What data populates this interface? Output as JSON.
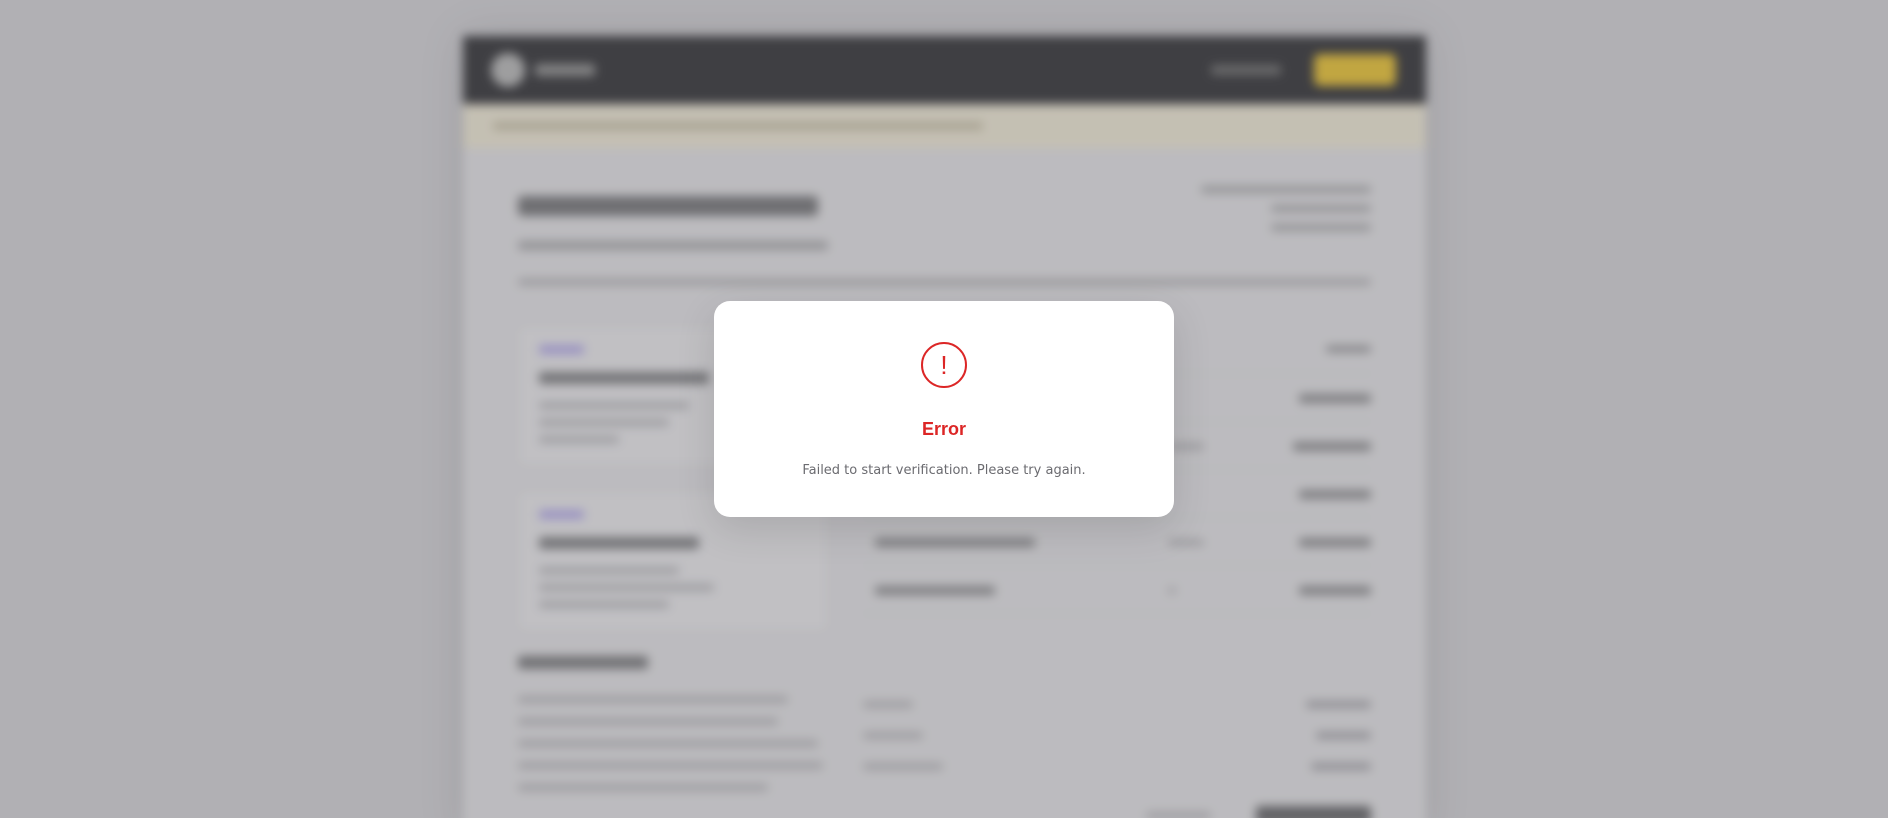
{
  "dialog": {
    "icon": "exclamation-circle-icon",
    "icon_glyph": "!",
    "title": "Error",
    "message": "Failed to start verification. Please try again."
  },
  "colors": {
    "error": "#dc2626",
    "message_text": "#6b6b70",
    "modal_background": "#ffffff",
    "page_backdrop": "#b3b2b6"
  }
}
